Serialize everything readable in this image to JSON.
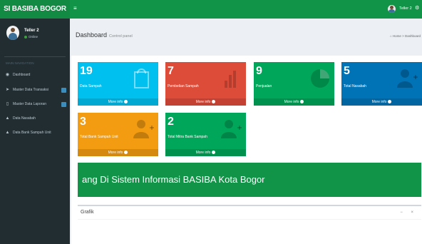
{
  "app": {
    "logo": "SI BASIBA BOGOR"
  },
  "user": {
    "name": "Teller 2",
    "status": "Online"
  },
  "sidebar": {
    "header": "MAIN NAVIGATION",
    "items": [
      {
        "label": "Dashboard",
        "icon": "dashboard-icon"
      },
      {
        "label": "Master Data Transaksi",
        "icon": "send-icon"
      },
      {
        "label": "Master Data Laporan",
        "icon": "file-icon"
      },
      {
        "label": "Data Nasabah",
        "icon": "user-icon"
      },
      {
        "label": "Data Bank Sampah Unit",
        "icon": "user-icon"
      }
    ]
  },
  "header": {
    "toggle": "≡",
    "user_name": "Teller 2",
    "gear": "⚙"
  },
  "page": {
    "title": "Dashboard",
    "subtitle": "Control panel",
    "breadcrumb": "Home > Dashboard"
  },
  "boxes": [
    {
      "value": "19",
      "label": "Data Sampah",
      "footer": "More info",
      "color": "#00c0ef"
    },
    {
      "value": "7",
      "label": "Pembelian Sampah",
      "footer": "More info",
      "color": "#dd4b39"
    },
    {
      "value": "9",
      "label": "Penjualan",
      "footer": "More info",
      "color": "#00a65a"
    },
    {
      "value": "5",
      "label": "Total Nasabah",
      "footer": "More info",
      "color": "#0073b7"
    },
    {
      "value": "3",
      "label": "Total Bank Sampah Unit",
      "footer": "More info",
      "color": "#f39c12"
    },
    {
      "value": "2",
      "label": "Total Mitra Bank Sampah",
      "footer": "More info",
      "color": "#00a65a"
    }
  ],
  "banner": {
    "text": "ang Di Sistem Informasi BASIBA Kota Bogor"
  },
  "grafik": {
    "title": "Grafik",
    "tools": "− ×"
  }
}
